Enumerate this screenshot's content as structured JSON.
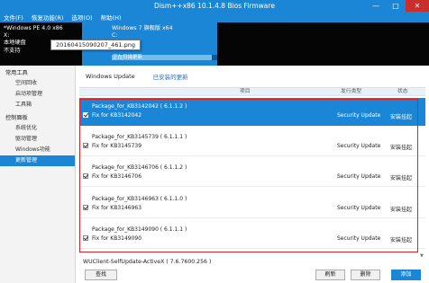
{
  "window": {
    "title": "Dism++x86 10.1.4.8 Bios Firmware",
    "minimize": "—",
    "maximize": "□",
    "close": "✕"
  },
  "menu": [
    "文件(F)",
    "恢复功能(R)",
    "选项(O)",
    "帮助(H)"
  ],
  "sessions": [
    {
      "lines": [
        "*Windows PE 4.0 x86",
        "X:",
        "本地硬盘",
        "不支持"
      ]
    },
    {
      "lines": [
        "Windows 7 旗舰版 x64",
        "C:"
      ],
      "progress_text": "正在扫描更新",
      "progress": 0.95
    }
  ],
  "tooltip": "20160415090207_461.png",
  "sidebar": {
    "groups": [
      {
        "header": "常用工具",
        "items": [
          "空间回收",
          "启动项管理",
          "工具箱"
        ]
      },
      {
        "header": "控制面板",
        "items": [
          "系统优化",
          "驱动管理",
          "Windows功能",
          "更新管理"
        ]
      }
    ],
    "active": "更新管理"
  },
  "tabs": {
    "active": "Windows Update",
    "link": "已安装的更新"
  },
  "columns": {
    "item": "项目",
    "type": "发行类型",
    "status": "状态"
  },
  "updates": [
    {
      "name": "Package_for_KB3142042 ( 6.1.1.2 )",
      "desc": "Fix for KB3142042",
      "type": "Security Update",
      "status": "安装挂起",
      "selected": true
    },
    {
      "name": "Package_for_KB3145739 ( 6.1.1.1 )",
      "desc": "Fix for KB3145739",
      "type": "Security Update",
      "status": "安装挂起",
      "selected": false
    },
    {
      "name": "Package_for_KB3146706 ( 6.1.1.2 )",
      "desc": "Fix for KB3146706",
      "type": "Security Update",
      "status": "安装挂起",
      "selected": false
    },
    {
      "name": "Package_for_KB3146963 ( 6.1.1.0 )",
      "desc": "Fix for KB3146963",
      "type": "Security Update",
      "status": "安装挂起",
      "selected": false
    },
    {
      "name": "Package_for_KB3149090 ( 6.1.1.1 )",
      "desc": "Fix for KB3149090",
      "type": "Security Update",
      "status": "安装挂起",
      "selected": false
    }
  ],
  "footer_item": "WUClient-SelfUpdate-ActiveX ( 7.6.7600.256 )",
  "buttons": {
    "find": "查找",
    "refresh": "刷新",
    "delete": "删除",
    "add": "添加"
  },
  "colors": {
    "accent": "#1c86d6",
    "highlight": "#e02020",
    "close": "#c9302c"
  }
}
